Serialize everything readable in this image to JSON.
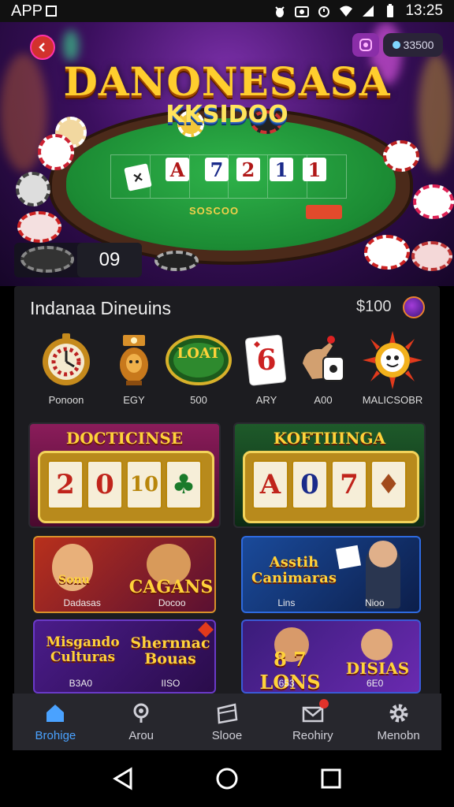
{
  "status_bar": {
    "app_label": "APP",
    "time": "13:25",
    "icons": [
      "bug-icon",
      "camera-icon",
      "alarm-icon",
      "wifi-icon",
      "signal-icon",
      "battery-icon"
    ]
  },
  "hero": {
    "title": "DANONESASA",
    "subtitle": "KKSIDOO",
    "coin_balance": "33500",
    "table_label": "SOSCOO",
    "chip_counter": "09",
    "cards": [
      "A",
      "7",
      "2",
      "1",
      "1"
    ]
  },
  "section": {
    "title": "Indanaa Dineuins",
    "balance": "$100"
  },
  "categories": [
    {
      "label": "Ponoon",
      "icon": "roulette-clock-icon"
    },
    {
      "label": "EGY",
      "icon": "trophy-bell-icon"
    },
    {
      "label": "500",
      "icon": "lottery-badge-icon",
      "badge_text": "LOAT"
    },
    {
      "label": "ARY",
      "icon": "card-six-icon",
      "card_value": "6"
    },
    {
      "label": "A00",
      "icon": "dice-hand-icon"
    },
    {
      "label": "MALICSOBR",
      "icon": "sunburst-face-icon"
    }
  ],
  "games": [
    {
      "title": "DOCTICINSE",
      "reels": [
        "2",
        "0",
        "10",
        "♣"
      ]
    },
    {
      "title": "KOFTIIINGA",
      "reels": [
        "A",
        "0",
        "7",
        "♦"
      ]
    },
    {
      "title": "CAGANS",
      "left": "Sonu",
      "subs": [
        "Dadasas",
        "Docoo"
      ]
    },
    {
      "title": "Asstih Canimaras",
      "subs": [
        "Lins",
        "Nioo"
      ]
    },
    {
      "title": "Misgando Culturas",
      "title2": "Shernnac Bouas",
      "subs": [
        "B3A0",
        "IISO"
      ]
    },
    {
      "title": "8 7 LONS",
      "title2": "DISIAS",
      "subs": [
        "653",
        "6E0"
      ]
    }
  ],
  "bottom_nav": [
    {
      "label": "Brohige",
      "icon": "home-icon",
      "active": true
    },
    {
      "label": "Arou",
      "icon": "location-pin-icon",
      "active": false
    },
    {
      "label": "Slooe",
      "icon": "folder-icon",
      "active": false
    },
    {
      "label": "Reohiry",
      "icon": "mail-icon",
      "active": false,
      "badge": true
    },
    {
      "label": "Menobn",
      "icon": "gear-icon",
      "active": false
    }
  ],
  "colors": {
    "accent": "#4aa2ff",
    "panel": "#1c1c20",
    "nav": "#27272d",
    "gold": "#ffce2e",
    "felt": "#1b8a33"
  }
}
